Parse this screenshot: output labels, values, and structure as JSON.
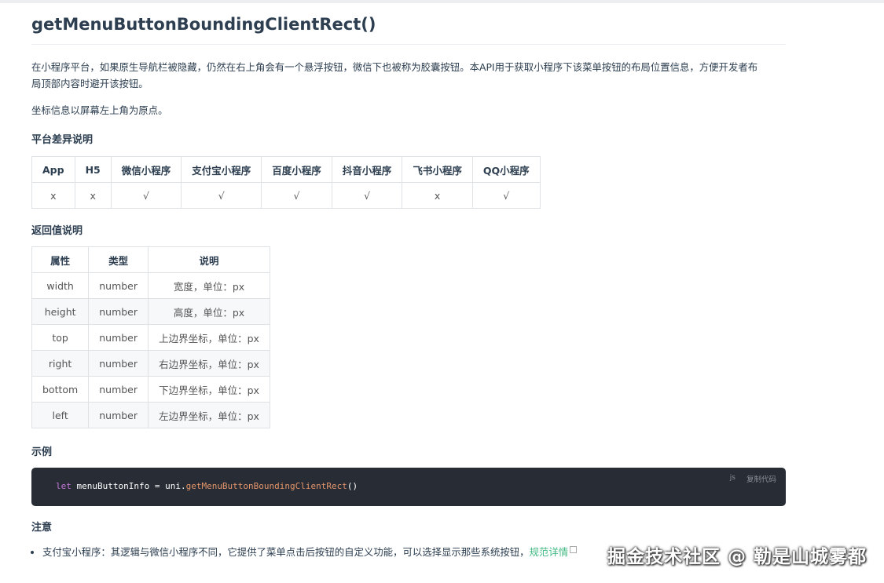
{
  "title": "getMenuButtonBoundingClientRect()",
  "intro": "在小程序平台，如果原生导航栏被隐藏，仍然在右上角会有一个悬浮按钮，微信下也被称为胶囊按钮。本API用于获取小程序下该菜单按钮的布局位置信息，方便开发者布局顶部内容时避开该按钮。",
  "intro_line1": "在小程序平台，如果原生导航栏被隐藏，仍然在右上角会有一个悬浮按钮，微信下也被称为胶囊按钮。本API用于获取小程序下该菜单按钮的布局位置信息，方便开发者布",
  "intro_line2": "局顶部内容时避开该按钮。",
  "coord_note": "坐标信息以屏幕左上角为原点。",
  "platform_heading": "平台差异说明",
  "platform_table": {
    "headers": [
      "App",
      "H5",
      "微信小程序",
      "支付宝小程序",
      "百度小程序",
      "抖音小程序",
      "飞书小程序",
      "QQ小程序"
    ],
    "row": [
      "x",
      "x",
      "√",
      "√",
      "√",
      "√",
      "x",
      "√"
    ]
  },
  "return_heading": "返回值说明",
  "return_table": {
    "headers": [
      "属性",
      "类型",
      "说明"
    ],
    "rows": [
      [
        "width",
        "number",
        "宽度，单位：px"
      ],
      [
        "height",
        "number",
        "高度，单位：px"
      ],
      [
        "top",
        "number",
        "上边界坐标，单位：px"
      ],
      [
        "right",
        "number",
        "右边界坐标，单位：px"
      ],
      [
        "bottom",
        "number",
        "下边界坐标，单位：px"
      ],
      [
        "left",
        "number",
        "左边界坐标，单位：px"
      ]
    ]
  },
  "example_heading": "示例",
  "code": {
    "keyword": "let",
    "var": " menuButtonInfo = uni.",
    "fn": "getMenuButtonBoundingClientRect",
    "tail": "()",
    "lang": "js",
    "copy_label": "复制代码"
  },
  "note_heading": "注意",
  "note_item": "支付宝小程序：其逻辑与微信小程序不同，它提供了菜单点击后按钮的自定义功能，可以选择显示那些系统按钮，",
  "note_link": "规范详情",
  "watermark": "掘金技术社区 @ 勒是山城雾都",
  "colors": {
    "link": "#42b983",
    "code_bg": "#282c34",
    "text": "#2c3e50"
  }
}
